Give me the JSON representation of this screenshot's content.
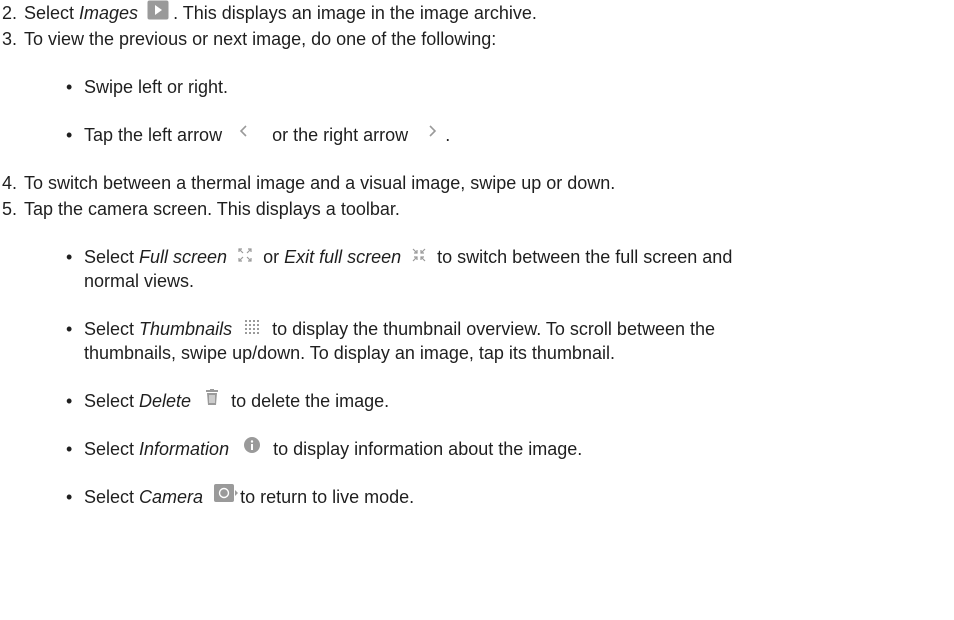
{
  "steps": [
    {
      "num": "2.",
      "pre": "Select ",
      "em": "Images",
      "post": ". This displays an image in the image archive."
    },
    {
      "num": "3.",
      "text": "To view the previous or next image, do one of the following:"
    },
    {
      "num": "4.",
      "text": "To switch between a thermal image and a visual image, swipe up or down."
    },
    {
      "num": "5.",
      "text": "Tap the camera screen. This displays a toolbar."
    }
  ],
  "step3_bullets": {
    "swipe": "Swipe left or right.",
    "tap_pre": "Tap the left arrow",
    "tap_mid": "or the right arrow",
    "tap_post": "."
  },
  "step5_bullets": {
    "fullscreen": {
      "pre": "Select ",
      "em1": "Full screen",
      "mid": " or ",
      "em2": "Exit full screen",
      "post": " to switch between the full screen and",
      "line2": "normal views."
    },
    "thumbnails": {
      "pre": "Select ",
      "em": "Thumbnails",
      "post": " to display the thumbnail overview. To scroll between the",
      "line2": "thumbnails, swipe up/down. To display an image, tap its thumbnail."
    },
    "delete": {
      "pre": "Select ",
      "em": "Delete",
      "post": " to delete the image."
    },
    "information": {
      "pre": "Select ",
      "em": "Information",
      "post": " to display information about the image."
    },
    "camera": {
      "pre": "Select ",
      "em": "Camera",
      "post": "to return to live mode."
    }
  },
  "bullet_glyph": "•",
  "icons": {
    "images": "play-thumbnail-icon",
    "left_arrow": "chevron-left-icon",
    "right_arrow": "chevron-right-icon",
    "full_screen": "expand-icon",
    "exit_full_screen": "collapse-icon",
    "thumbnails": "grid-icon",
    "delete": "trash-icon",
    "information": "info-icon",
    "camera": "camera-icon"
  },
  "colors": {
    "text": "#1f1f1f",
    "icon": "#9a9a9a"
  }
}
